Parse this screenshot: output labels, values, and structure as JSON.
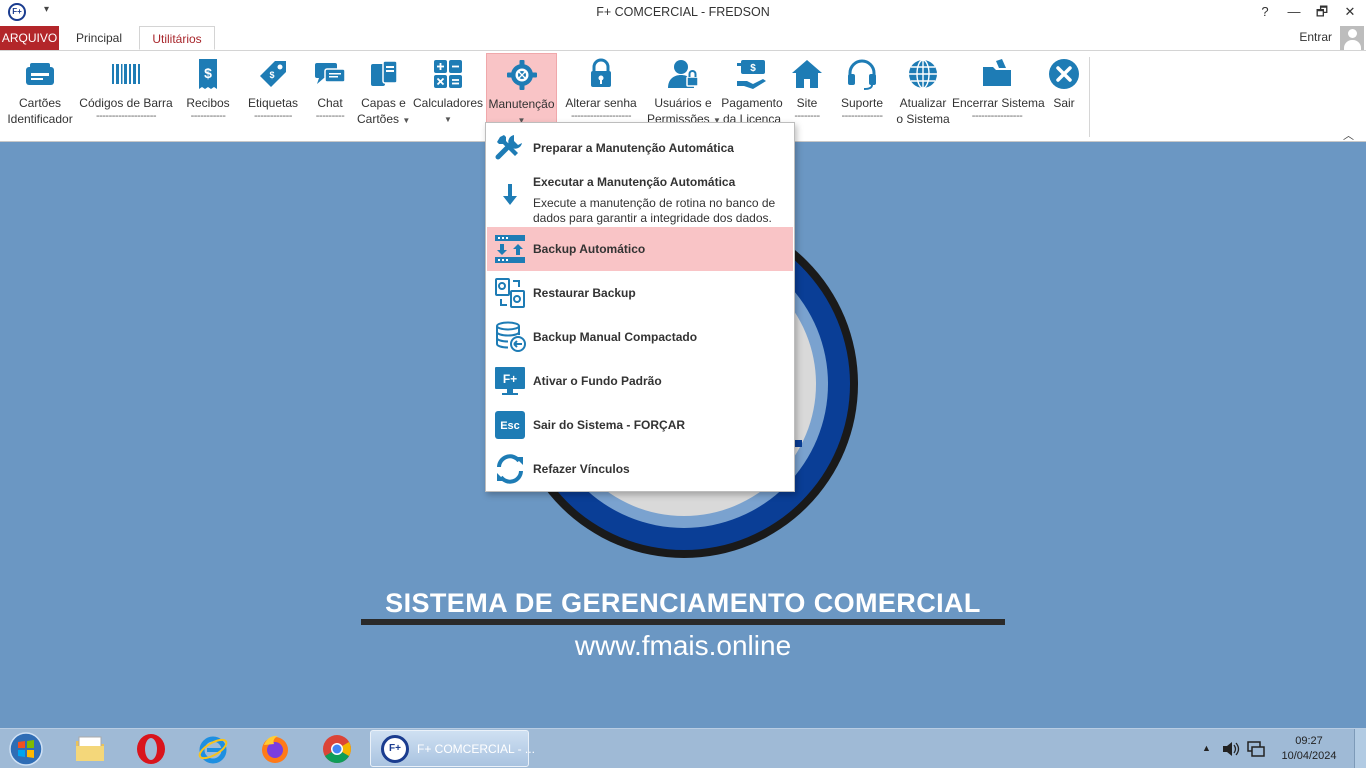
{
  "window": {
    "title": "F+ COMCERCIAL - FREDSON",
    "logo_text": "F+",
    "help": "?",
    "minimize": "—",
    "restore": "🗗",
    "close": "✕"
  },
  "tabs": {
    "arquivo": "ARQUIVO",
    "principal": "Principal",
    "utilitarios": "Utilitários",
    "active": "Utilitários",
    "entrar": "Entrar"
  },
  "ribbon": {
    "buttons": [
      {
        "line1": "Cartões",
        "line2": "Identificador",
        "icon": "id-card-icon"
      },
      {
        "line1": "Códigos de Barra",
        "line2": "-------------------",
        "icon": "barcode-icon"
      },
      {
        "line1": "Recibos",
        "line2": "-----------",
        "icon": "receipt-icon"
      },
      {
        "line1": "Etiquetas",
        "line2": "------------",
        "icon": "tag-icon"
      },
      {
        "line1": "Chat",
        "line2": "---------",
        "icon": "chat-icon"
      },
      {
        "line1": "Capas e",
        "line2": "Cartões",
        "icon": "cards-icon"
      },
      {
        "line1": "Calculadores",
        "line2": "",
        "icon": "calculator-icon"
      },
      {
        "line1": "Manutenção",
        "line2": "",
        "icon": "maintenance-icon"
      },
      {
        "line1": "Alterar senha",
        "line2": "-------------------",
        "icon": "lock-icon"
      },
      {
        "line1": "Usuários e",
        "line2": "Permissões",
        "icon": "user-icon"
      },
      {
        "line1": "Pagamento",
        "line2": "da Licença",
        "icon": "payment-icon"
      },
      {
        "line1": "Site",
        "line2": "--------",
        "icon": "home-icon"
      },
      {
        "line1": "Suporte",
        "line2": "-------------",
        "icon": "headset-icon"
      },
      {
        "line1": "Atualizar",
        "line2": "o Sistema",
        "icon": "globe-icon"
      },
      {
        "line1": "Encerrar Sistema",
        "line2": "----------------",
        "icon": "folder-icon"
      },
      {
        "line1": "Sair",
        "line2": "",
        "icon": "close-circle-icon"
      }
    ]
  },
  "menu": {
    "items": [
      {
        "label": "Preparar a Manutenção Automática",
        "icon": "tools-icon"
      },
      {
        "label": "Executar a Manutenção Automática",
        "desc": "Execute a manutenção de rotina no banco de dados para garantir a integridade dos dados.",
        "icon": "arrow-down-icon"
      },
      {
        "label": "Backup Automático",
        "icon": "server-transfer-icon",
        "highlighted": true
      },
      {
        "label": "Restaurar Backup",
        "icon": "restore-icon"
      },
      {
        "label": "Backup Manual Compactado",
        "icon": "database-icon"
      },
      {
        "label": "Ativar o Fundo Padrão",
        "icon": "monitor-icon",
        "badge": "F+"
      },
      {
        "label": "Sair do Sistema - FORÇAR",
        "icon": "esc-key-icon",
        "badge": "Esc"
      },
      {
        "label": "Refazer Vínculos",
        "icon": "refresh-icon"
      }
    ]
  },
  "background": {
    "slogan": "SISTEMA DE GERENCIAMENTO COMERCIAL",
    "website": "www.fmais.online"
  },
  "taskbar": {
    "app_label": "F+ COMCERCIAL - ...",
    "app_logo": "F+",
    "time": "09:27",
    "date": "10/04/2024",
    "tray_arrow": "▲"
  },
  "colors": {
    "accent_red": "#b3262a",
    "icon_blue": "#1e7cb5",
    "highlight": "#f9c4c6",
    "desktop_bg": "#6b97c3"
  }
}
